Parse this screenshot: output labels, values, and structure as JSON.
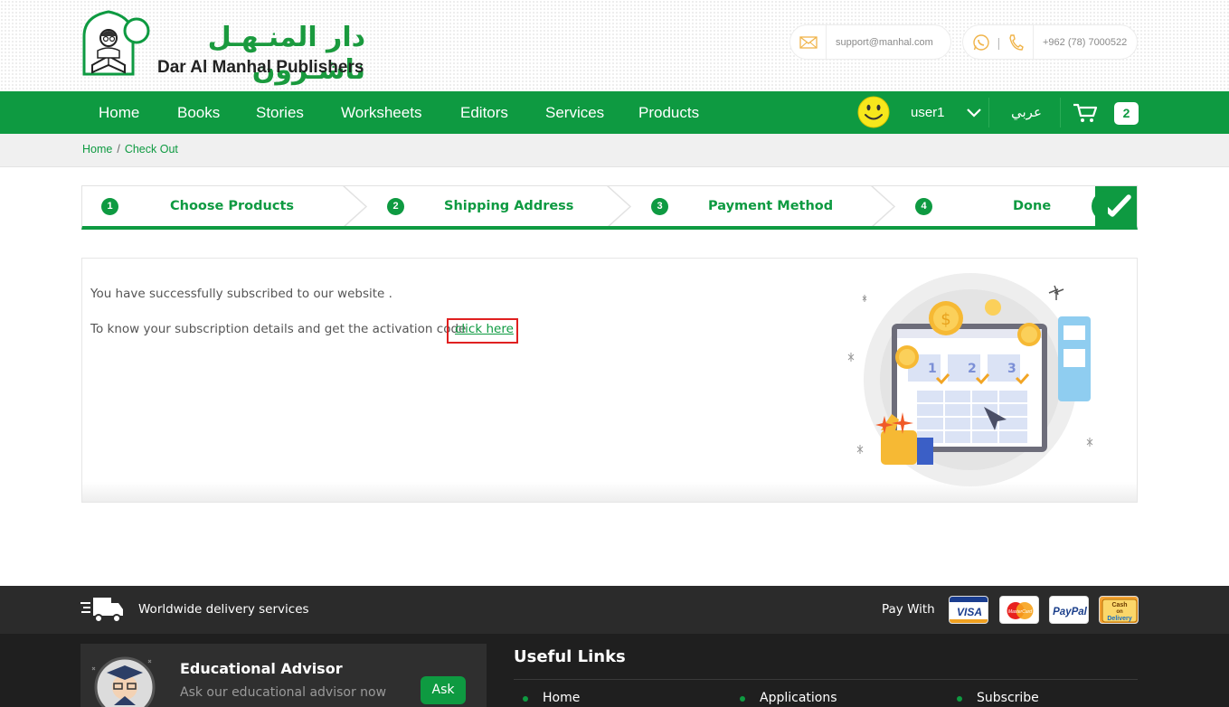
{
  "header": {
    "logo_arabic": "دار المنـهـل ناشـرون",
    "logo_english": "Dar Al Manhal Publishers",
    "email": "support@manhal.com",
    "phone": "+962 (78) 7000522",
    "phone_separator": "|"
  },
  "nav": {
    "items": [
      "Home",
      "Books",
      "Stories",
      "Worksheets",
      "Editors",
      "Services",
      "Products"
    ],
    "username": "user1",
    "language": "عربي",
    "cart_count": "2",
    "accent_color": "#0e9a41"
  },
  "breadcrumb": {
    "home": "Home",
    "separator": "/",
    "current": "Check Out"
  },
  "steps": [
    {
      "number": "1",
      "label": "Choose Products"
    },
    {
      "number": "2",
      "label": "Shipping Address"
    },
    {
      "number": "3",
      "label": "Payment Method"
    },
    {
      "number": "4",
      "label": "Done"
    }
  ],
  "content": {
    "success_message": "You have successfully subscribed to our website .",
    "details_message": "To know your subscription details and get the activation code",
    "link_text": "click here",
    "illustration_labels": [
      "1",
      "2",
      "3"
    ]
  },
  "footer": {
    "delivery_text": "Worldwide delivery services",
    "pay_with": "Pay With",
    "payment_methods": [
      "VISA",
      "MasterCard",
      "PayPal",
      "Cash on Delivery"
    ],
    "cash_card_lines": [
      "Cash",
      "on",
      "Delivery"
    ],
    "advisor_title": "Educational Advisor",
    "advisor_subtitle": "Ask our educational advisor now",
    "ask_label": "Ask",
    "useful_links_title": "Useful Links",
    "links": [
      "Home",
      "Applications",
      "Subscribe"
    ]
  }
}
